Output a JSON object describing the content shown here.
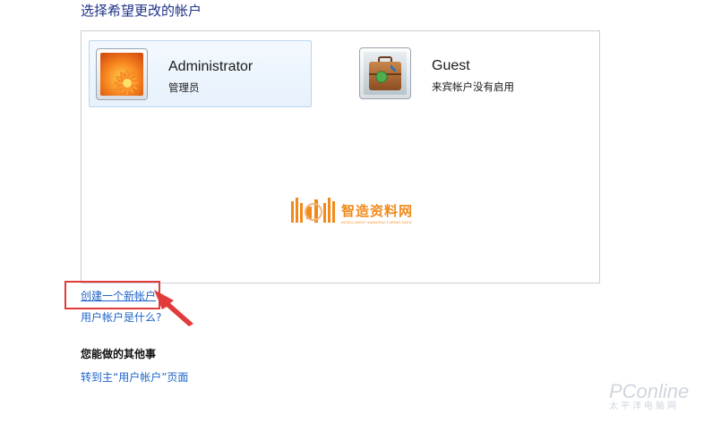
{
  "page": {
    "title": "选择希望更改的帐户"
  },
  "accounts": [
    {
      "name": "Administrator",
      "type": "管理员",
      "picture": "orange-flower-avatar",
      "selected": true
    },
    {
      "name": "Guest",
      "type": "来宾帐户没有启用",
      "picture": "briefcase-avatar",
      "selected": false
    }
  ],
  "links": {
    "create_account": "创建一个新帐户",
    "what_is_account": "用户帐户是什么?"
  },
  "other_tasks": {
    "heading": "您能做的其他事",
    "goto_user_accounts": "转到主“用户帐户”页面"
  },
  "watermark": {
    "logo_text": "智造资料网",
    "logo_subtext": "INTELLIGENT MANUFACTURING DATA",
    "site_main": "PConline",
    "site_sub": "太平洋电脑网"
  },
  "annotation": {
    "color": "#e23b3b"
  },
  "colors": {
    "title": "#1e3287",
    "link": "#1e64c8",
    "selection_border": "#b8d6f1",
    "panel_border": "#c9cdd3",
    "watermark_orange": "#f08a1c"
  }
}
